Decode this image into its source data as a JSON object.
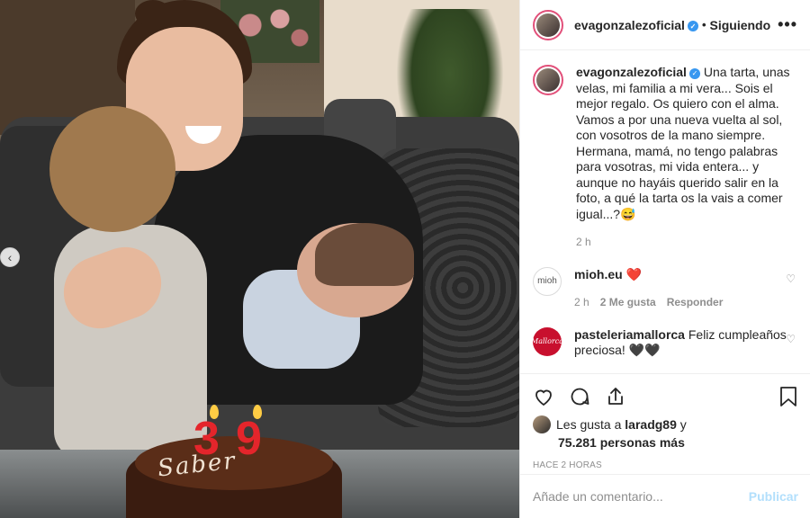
{
  "post": {
    "username": "evagonzalezoficial",
    "follow_separator": "•",
    "follow_status": "Siguiendo",
    "more_label": "•••",
    "photo": {
      "cake_text": "Saber",
      "candle_digits": [
        "3",
        "9"
      ],
      "carousel_prev": "‹"
    }
  },
  "caption": {
    "username": "evagonzalezoficial",
    "text": "Una tarta, unas velas, mi familia a mi vera... Sois el mejor regalo. Os quiero con el alma.\nVamos a por una nueva vuelta al sol, con vosotros de la mano siempre. Hermana, mamá, no tengo palabras para vosotras, mi vida entera... y aunque no hayáis querido salir en la foto, a qué la tarta os la vais a comer igual...?😅",
    "time": "2 h"
  },
  "comments": [
    {
      "username": "mioh.eu",
      "avatar_text": "mioh",
      "text": "❤️",
      "time": "2 h",
      "likes": "2 Me gusta",
      "reply": "Responder"
    },
    {
      "username": "pasteleriamallorca",
      "avatar_text": "Mallorca",
      "text": "Feliz cumpleaños preciosa! 🖤🖤"
    }
  ],
  "likes": {
    "prefix": "Les gusta a",
    "user": "laradg89",
    "conjunction": "y",
    "count": "75.281 personas más"
  },
  "timestamp": "HACE 2 HORAS",
  "comment_box": {
    "placeholder": "Añade un comentario...",
    "publish": "Publicar"
  },
  "colors": {
    "verified": "#3897f0",
    "story_ring": "#e2507a",
    "publish_disabled": "#b2dffc",
    "comment_heart": "#ed4956",
    "candle": "#e4252b"
  },
  "icons": [
    "heart-icon",
    "comment-icon",
    "share-icon",
    "bookmark-icon",
    "verified-icon",
    "more-icon",
    "chevron-left-icon"
  ]
}
